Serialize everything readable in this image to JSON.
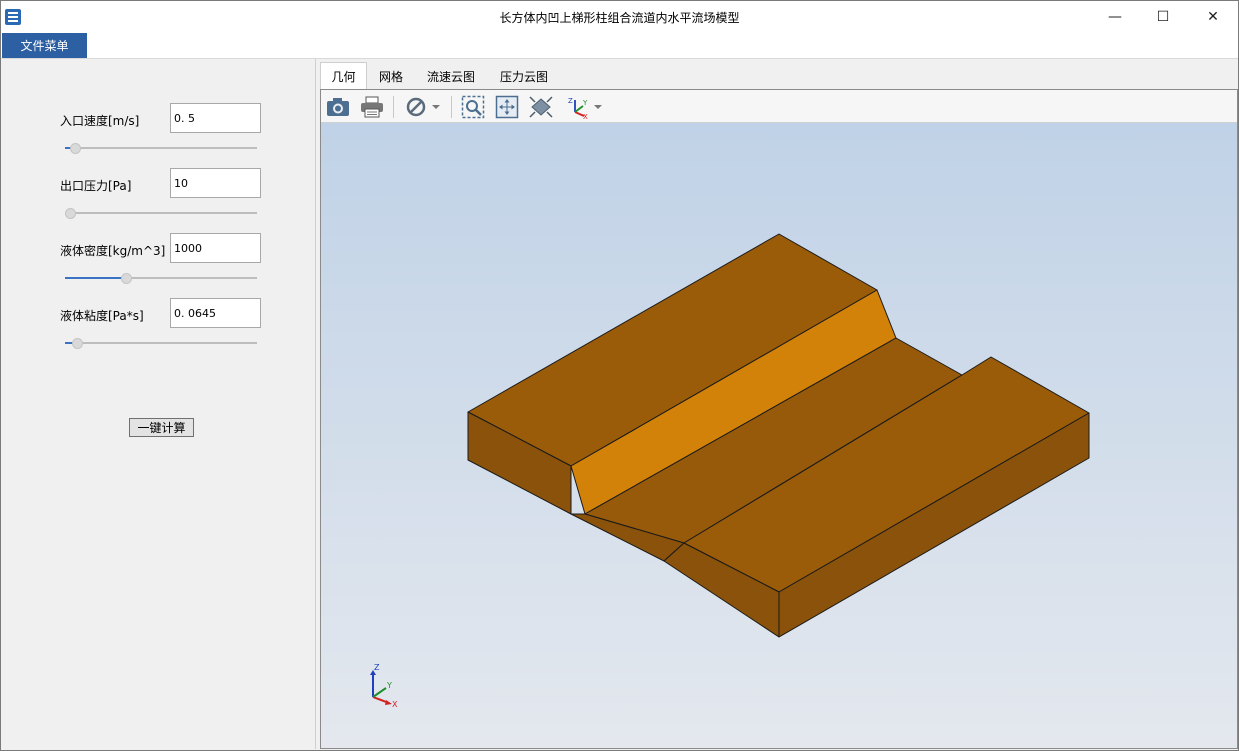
{
  "window": {
    "title": "长方体内凹上梯形柱组合流道内水平流场模型",
    "controls": {
      "minimize": "—",
      "maximize": "☐",
      "close": "✕"
    }
  },
  "menu": {
    "file_label": "文件菜单"
  },
  "params": [
    {
      "label": "入口速度[m/s]",
      "value": "0. 5",
      "slider_fraction": 0.03
    },
    {
      "label": "出口压力[Pa]",
      "value": "10",
      "slider_fraction": 0.0
    },
    {
      "label": "液体密度[kg/m^3]",
      "value": "1000",
      "slider_fraction": 0.31
    },
    {
      "label": "液体粘度[Pa*s]",
      "value": "0. 0645",
      "slider_fraction": 0.04
    }
  ],
  "calc_button": "一键计算",
  "tabs": [
    {
      "label": "几何",
      "active": true
    },
    {
      "label": "网格",
      "active": false
    },
    {
      "label": "流速云图",
      "active": false
    },
    {
      "label": "压力云图",
      "active": false
    }
  ],
  "toolbar_icons": [
    "camera-icon",
    "print-icon",
    "display-mode-icon",
    "dropdown-arrow-icon",
    "zoom-box-icon",
    "zoom-extents-icon",
    "view-fit-icon",
    "axes-view-icon",
    "dropdown-arrow-icon"
  ],
  "axis_triad": {
    "z": "Z",
    "y": "Y",
    "x": "X"
  },
  "colors": {
    "accent": "#2d5fa3",
    "model_top": "#9b5c0a",
    "model_side": "#8a520a",
    "model_slope": "#d28208",
    "viewport_top": "#c0d2e7",
    "viewport_bottom": "#e4e8ee"
  }
}
